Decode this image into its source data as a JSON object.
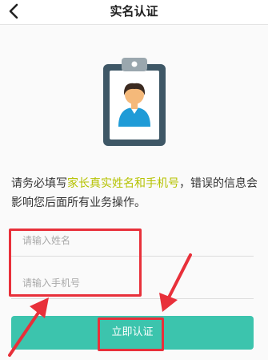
{
  "header": {
    "title": "实名认证"
  },
  "intro": {
    "prefix": "请务必填写",
    "highlight": "家长真实姓名和手机号",
    "suffix": "，错误的信息会影响您后面所有业务操作。"
  },
  "form": {
    "name_placeholder": "请输入姓名",
    "phone_placeholder": "请输入手机号"
  },
  "submit": {
    "label": "立即认证"
  },
  "colors": {
    "accent": "#3cc4ad",
    "highlight": "#b5c200",
    "badge_frame": "#3e5766",
    "annotation": "#e8303a"
  },
  "icons": {
    "back": "chevron-left-icon",
    "badge": "id-badge-icon"
  }
}
